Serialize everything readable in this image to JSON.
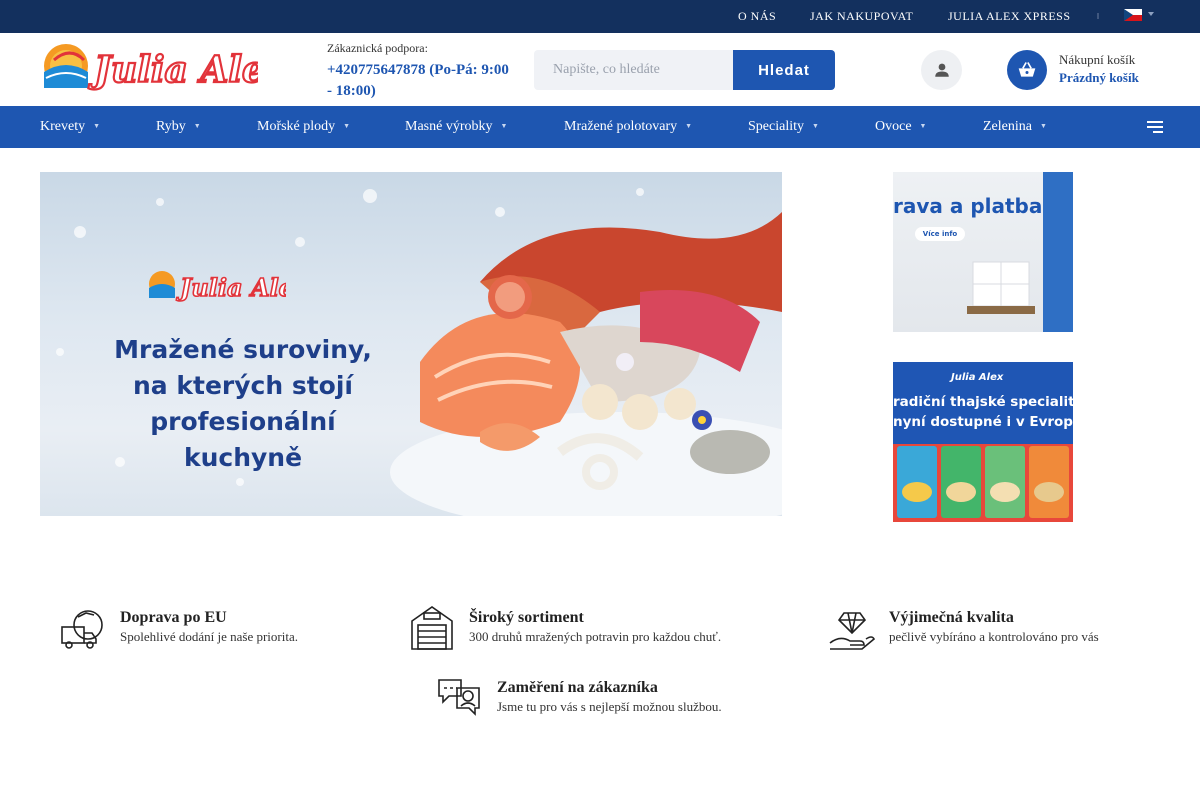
{
  "topbar": {
    "links": [
      "O NÁS",
      "JAK NAKUPOVAT",
      "JULIA ALEX XPRESS"
    ],
    "language": "CZ"
  },
  "header": {
    "logo_text": "Julia Alex",
    "support_label": "Zákaznická podpora:",
    "support_phone": "+420775647878 (Po-Pá: 9:00 - 18:00)",
    "search": {
      "placeholder": "Napište, co hledáte",
      "button": "Hledat"
    },
    "cart": {
      "title": "Nákupní košík",
      "status": "Prázdný košík"
    }
  },
  "nav": {
    "items": [
      "Krevety",
      "Ryby",
      "Mořské plody",
      "Masné výrobky",
      "Mražené polotovary",
      "Speciality",
      "Ovoce",
      "Zelenina"
    ]
  },
  "banner": {
    "logo_text": "Julia Alex",
    "line1": "Mražené suroviny,",
    "line2": "na kterých stojí",
    "line3": "profesionální kuchyně"
  },
  "side_banners": [
    {
      "text": "rava a platba",
      "pill": "Více info"
    },
    {
      "logo": "Julia Alex",
      "line1": "radiční thajské speciality",
      "line2": "nyní dostupné i v Evropě"
    }
  ],
  "features": [
    {
      "icon": "delivery-truck-icon",
      "title": "Doprava po EU",
      "desc": "Spolehlivé dodání je naše priorita."
    },
    {
      "icon": "warehouse-icon",
      "title": "Široký sortiment",
      "desc": "300 druhů mražených potravin pro každou chuť."
    },
    {
      "icon": "diamond-hand-icon",
      "title": "Výjimečná kvalita",
      "desc": "pečlivě vybíráno a kontrolováno pro vás"
    },
    {
      "icon": "customer-chat-icon",
      "title": "Zaměření na zákazníka",
      "desc": "Jsme tu pro vás s nejlepší možnou službou."
    }
  ],
  "colors": {
    "topbar": "#13305e",
    "primary": "#1e56b1",
    "logo_red": "#e2333a"
  }
}
